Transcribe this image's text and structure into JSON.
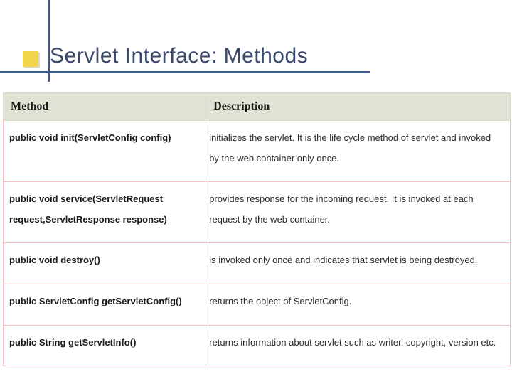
{
  "title": "Servlet Interface: Methods",
  "headers": {
    "method": "Method",
    "description": "Description"
  },
  "rows": [
    {
      "method": "public void init(ServletConfig config)",
      "description": "initializes the servlet. It is the life cycle method of servlet and invoked by the web container only once."
    },
    {
      "method": "public void service(ServletRequest request,ServletResponse response)",
      "description": "provides response for the incoming request. It is invoked at each request by the web container."
    },
    {
      "method": "public void destroy()",
      "description": "is invoked only once and indicates that servlet is being destroyed."
    },
    {
      "method": "public ServletConfig getServletConfig()",
      "description": "returns the object of ServletConfig."
    },
    {
      "method": "public String getServletInfo()",
      "description": "returns information about servlet such as writer, copyright, version etc."
    }
  ]
}
